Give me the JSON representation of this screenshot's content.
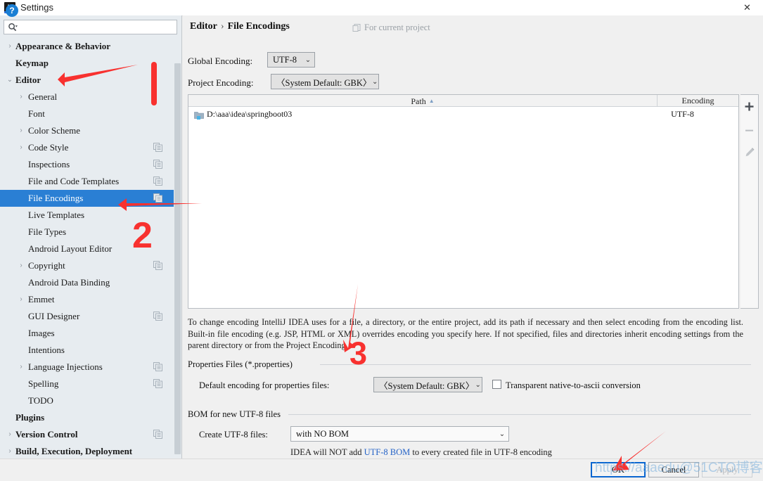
{
  "window": {
    "title": "Settings",
    "app_icon": "IJ",
    "close_label": "✕"
  },
  "search": {
    "value": "",
    "placeholder": ""
  },
  "sidebar": {
    "items": [
      {
        "label": "Appearance & Behavior",
        "level": 0,
        "arrow": "›",
        "has_arrow": true,
        "copy": false,
        "selected": false
      },
      {
        "label": "Keymap",
        "level": 0,
        "arrow": "",
        "has_arrow": false,
        "copy": false,
        "selected": false
      },
      {
        "label": "Editor",
        "level": 0,
        "arrow": "⌄",
        "has_arrow": true,
        "copy": false,
        "selected": false
      },
      {
        "label": "General",
        "level": 1,
        "arrow": "›",
        "has_arrow": true,
        "copy": false,
        "selected": false
      },
      {
        "label": "Font",
        "level": 1,
        "arrow": "",
        "has_arrow": false,
        "copy": false,
        "selected": false
      },
      {
        "label": "Color Scheme",
        "level": 1,
        "arrow": "›",
        "has_arrow": true,
        "copy": false,
        "selected": false
      },
      {
        "label": "Code Style",
        "level": 1,
        "arrow": "›",
        "has_arrow": true,
        "copy": true,
        "selected": false
      },
      {
        "label": "Inspections",
        "level": 1,
        "arrow": "",
        "has_arrow": false,
        "copy": true,
        "selected": false
      },
      {
        "label": "File and Code Templates",
        "level": 1,
        "arrow": "",
        "has_arrow": false,
        "copy": true,
        "selected": false
      },
      {
        "label": "File Encodings",
        "level": 1,
        "arrow": "",
        "has_arrow": false,
        "copy": true,
        "selected": true
      },
      {
        "label": "Live Templates",
        "level": 1,
        "arrow": "",
        "has_arrow": false,
        "copy": false,
        "selected": false
      },
      {
        "label": "File Types",
        "level": 1,
        "arrow": "",
        "has_arrow": false,
        "copy": false,
        "selected": false
      },
      {
        "label": "Android Layout Editor",
        "level": 1,
        "arrow": "",
        "has_arrow": false,
        "copy": false,
        "selected": false
      },
      {
        "label": "Copyright",
        "level": 1,
        "arrow": "›",
        "has_arrow": true,
        "copy": true,
        "selected": false
      },
      {
        "label": "Android Data Binding",
        "level": 1,
        "arrow": "",
        "has_arrow": false,
        "copy": false,
        "selected": false
      },
      {
        "label": "Emmet",
        "level": 1,
        "arrow": "›",
        "has_arrow": true,
        "copy": false,
        "selected": false
      },
      {
        "label": "GUI Designer",
        "level": 1,
        "arrow": "",
        "has_arrow": false,
        "copy": true,
        "selected": false
      },
      {
        "label": "Images",
        "level": 1,
        "arrow": "",
        "has_arrow": false,
        "copy": false,
        "selected": false
      },
      {
        "label": "Intentions",
        "level": 1,
        "arrow": "",
        "has_arrow": false,
        "copy": false,
        "selected": false
      },
      {
        "label": "Language Injections",
        "level": 1,
        "arrow": "›",
        "has_arrow": true,
        "copy": true,
        "selected": false
      },
      {
        "label": "Spelling",
        "level": 1,
        "arrow": "",
        "has_arrow": false,
        "copy": true,
        "selected": false
      },
      {
        "label": "TODO",
        "level": 1,
        "arrow": "",
        "has_arrow": false,
        "copy": false,
        "selected": false
      },
      {
        "label": "Plugins",
        "level": 0,
        "arrow": "",
        "has_arrow": false,
        "copy": false,
        "selected": false
      },
      {
        "label": "Version Control",
        "level": 0,
        "arrow": "›",
        "has_arrow": true,
        "copy": true,
        "selected": false
      },
      {
        "label": "Build, Execution, Deployment",
        "level": 0,
        "arrow": "›",
        "has_arrow": true,
        "copy": false,
        "selected": false
      }
    ]
  },
  "main": {
    "breadcrumb": {
      "parent": "Editor",
      "separator": "›",
      "current": "File Encodings"
    },
    "scope_note": "For current project",
    "global_encoding": {
      "label": "Global Encoding:",
      "value": "UTF-8"
    },
    "project_encoding": {
      "label": "Project Encoding:",
      "value": "〈System Default: GBK〉"
    },
    "table": {
      "columns": [
        "Path",
        "Encoding"
      ],
      "sort_column": "Path",
      "sort_dir": "▲",
      "rows": [
        {
          "path": "D:\\aaa\\idea\\springboot03",
          "encoding": "UTF-8"
        }
      ]
    },
    "table_buttons": [
      {
        "name": "add",
        "glyph": "+"
      },
      {
        "name": "remove",
        "glyph": "−"
      },
      {
        "name": "edit",
        "glyph": "pencil"
      }
    ],
    "description": "To change encoding IntelliJ IDEA uses for a file, a directory, or the entire project, add its path if necessary and then select encoding from the encoding list. Built-in file encoding (e.g. JSP, HTML or XML) overrides encoding you specify here. If not specified, files and directories inherit encoding settings from the parent directory or from the Project Encoding.",
    "properties_group": {
      "title": "Properties Files (*.properties)",
      "default_encoding_label": "Default encoding for properties files:",
      "default_encoding_value": "〈System Default: GBK〉",
      "transparent_label": "Transparent native-to-ascii conversion",
      "transparent_checked": false
    },
    "bom_group": {
      "title": "BOM for new UTF-8 files",
      "create_label": "Create UTF-8 files:",
      "create_value": "with NO BOM",
      "hint_prefix": "IDEA will NOT add ",
      "hint_link": "UTF-8 BOM",
      "hint_suffix": " to every created file in UTF-8 encoding"
    }
  },
  "footer": {
    "help_glyph": "?",
    "ok_label": "OK",
    "cancel_label": "Cancel",
    "apply_label": "Apply"
  },
  "annotations": {
    "marks": [
      {
        "label": "1"
      },
      {
        "label": "2"
      },
      {
        "label": "3"
      }
    ],
    "watermark": "https://aaaedu@51CTO博客"
  },
  "colors": {
    "selection": "#2a7fd4",
    "annotation_red": "#f8312f",
    "link_blue": "#2563c7",
    "ok_border": "#0a66d0"
  }
}
